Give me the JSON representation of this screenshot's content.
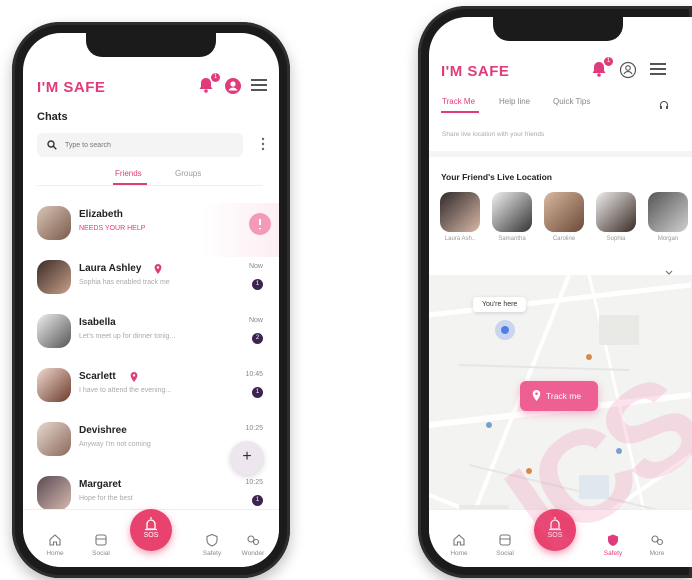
{
  "chat_screen": {
    "brand": "I'M SAFE",
    "bell_badge": "1",
    "title": "Chats",
    "search_placeholder": "Type to search",
    "tabs": [
      "Friends",
      "Groups"
    ],
    "chats": [
      {
        "name": "Elizabeth",
        "message": "NEEDS YOUR HELP",
        "time": "",
        "badge": "",
        "alert": true
      },
      {
        "name": "Laura Ashley",
        "message": "Sophia has enabled track me",
        "time": "Now",
        "badge": "1",
        "pin": true
      },
      {
        "name": "Isabella",
        "message": "Let's meet up for dinner tonig...",
        "time": "Now",
        "badge": "2"
      },
      {
        "name": "Scarlett",
        "message": "I have to attend the evening...",
        "time": "10:45",
        "badge": "1",
        "pin": true
      },
      {
        "name": "Devishree",
        "message": "Anyway I'm not coming",
        "time": "10:25",
        "badge": ""
      },
      {
        "name": "Margaret",
        "message": "Hope for the best",
        "time": "10:25",
        "badge": "1"
      }
    ],
    "fab": "+",
    "nav": [
      "Home",
      "Social",
      "SOS",
      "Safety",
      "Wonder"
    ]
  },
  "map_screen": {
    "brand": "I'M SAFE",
    "bell_badge": "1",
    "tabs": [
      "Track Me",
      "Help line",
      "Quick Tips"
    ],
    "subtitle": "Share live location with your friends",
    "section_title": "Your Friend's Live Location",
    "friends": [
      "Laura Ash..",
      "Samantha",
      "Caroline",
      "Sophia",
      "Morgan"
    ],
    "you_are_here": "You're here",
    "track_button": "Track me",
    "nav": [
      "Home",
      "Social",
      "SOS",
      "Safety",
      "More"
    ]
  },
  "watermark": "ICS",
  "colors": {
    "accent": "#e03c7c",
    "sos": "#e8436f",
    "badge": "#3d2350"
  }
}
